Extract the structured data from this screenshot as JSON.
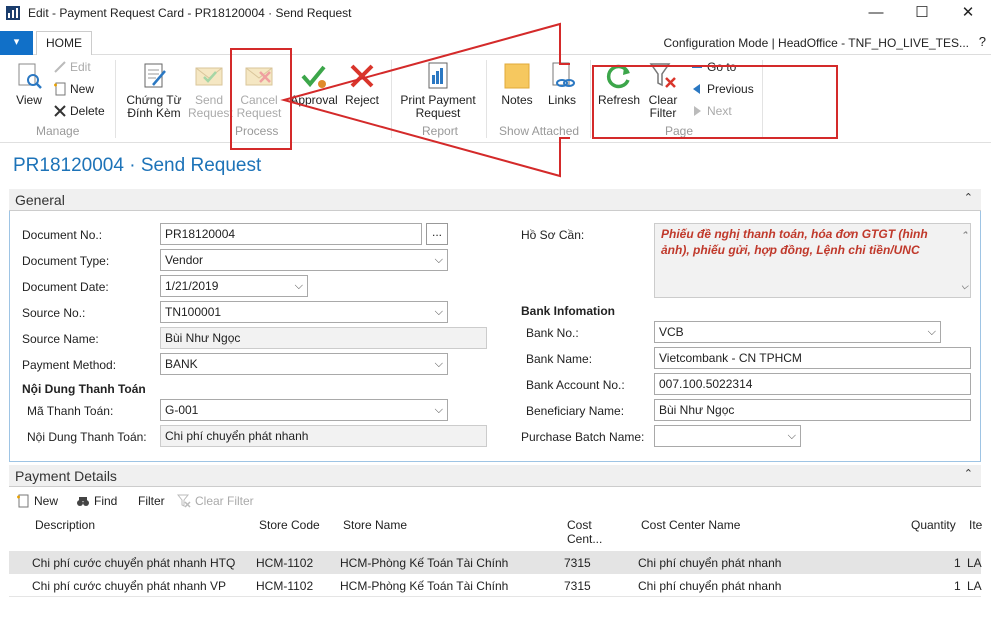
{
  "window": {
    "title": "Edit - Payment Request Card - PR18120004 · Send Request",
    "minimize": "—",
    "maximize": "☐",
    "close": "✕"
  },
  "tabs": {
    "file": "▾",
    "home": "HOME",
    "config": "Configuration Mode | HeadOffice - TNF_HO_LIVE_TES...",
    "help": "?"
  },
  "ribbon": {
    "manage": {
      "view": "View",
      "edit": "Edit",
      "new": "New",
      "delete": "Delete",
      "label": "Manage"
    },
    "process": {
      "chung_tu": [
        "Chứng Từ",
        "Đính Kèm"
      ],
      "send": [
        "Send",
        "Request"
      ],
      "cancel": [
        "Cancel",
        "Request"
      ],
      "approval": "Approval",
      "reject": "Reject",
      "label": "Process"
    },
    "report": {
      "print": [
        "Print Payment",
        "Request"
      ],
      "label": "Report"
    },
    "attached": {
      "notes": "Notes",
      "links": "Links",
      "label": "Show Attached"
    },
    "page": {
      "refresh": "Refresh",
      "clear": [
        "Clear",
        "Filter"
      ],
      "goto": "Go to",
      "previous": "Previous",
      "next": "Next",
      "label": "Page"
    }
  },
  "page_title": "PR18120004 · Send Request",
  "general": {
    "tab_label": "General",
    "collapse_icon": "⌃",
    "document_no": {
      "label": "Document No.:",
      "value": "PR18120004"
    },
    "document_type": {
      "label": "Document Type:",
      "value": "Vendor"
    },
    "document_date": {
      "label": "Document Date:",
      "value": "1/21/2019"
    },
    "source_no": {
      "label": "Source No.:",
      "value": "TN100001"
    },
    "source_name": {
      "label": "Source Name:",
      "value": "Bùi Như Ngọc"
    },
    "payment_method": {
      "label": "Payment Method:",
      "value": "BANK"
    },
    "noi_dung_header": "Nội Dung Thanh Toán",
    "ma_thanh_toan": {
      "label": "Mã Thanh Toán:",
      "value": "G-001"
    },
    "noi_dung": {
      "label": "Nội Dung Thanh Toán:",
      "value": "Chi phí chuyển phát nhanh"
    },
    "ho_so_can": {
      "label": "Hồ Sơ Cần:",
      "value": "Phiếu đề nghị thanh toán, hóa đơn GTGT (hình ảnh), phiếu gửi, hợp đồng, Lệnh chi tiền/UNC"
    },
    "bank_header": "Bank Infomation",
    "bank_no": {
      "label": "Bank No.:",
      "value": "VCB"
    },
    "bank_name": {
      "label": "Bank Name:",
      "value": "Vietcombank - CN TPHCM"
    },
    "bank_account": {
      "label": "Bank Account No.:",
      "value": "007.100.5022314"
    },
    "beneficiary": {
      "label": "Beneficiary Name:",
      "value": "Bùi Như Ngọc"
    },
    "purchase_batch": {
      "label": "Purchase Batch Name:",
      "value": ""
    },
    "ellipsis": "..."
  },
  "payment_details": {
    "tab_label": "Payment Details",
    "toolbar": {
      "new": "New",
      "find": "Find",
      "filter": "Filter",
      "clear_filter": "Clear Filter"
    },
    "columns": [
      "Description",
      "Store Code",
      "Store Name",
      "Cost Cent...",
      "Cost Center Name",
      "Quantity",
      "Ite"
    ],
    "rows": [
      {
        "description": "Chi phí cước chuyển phát nhanh HTQ",
        "store_code": "HCM-1102",
        "store_name": "HCM-Phòng Kế Toán Tài Chính",
        "cost_center": "7315",
        "cost_center_name": "Chi phí chuyển phát nhanh",
        "quantity": "1",
        "item": "LA"
      },
      {
        "description": "Chi phí cước chuyển phát nhanh VP",
        "store_code": "HCM-1102",
        "store_name": "HCM-Phòng Kế Toán Tài Chính",
        "cost_center": "7315",
        "cost_center_name": "Chi phí chuyển phát nhanh",
        "quantity": "1",
        "item": "LA"
      }
    ]
  },
  "colors": {
    "accent": "#1d73b8",
    "annotation": "#d42a2a",
    "ho_so_text": "#c0392b"
  }
}
